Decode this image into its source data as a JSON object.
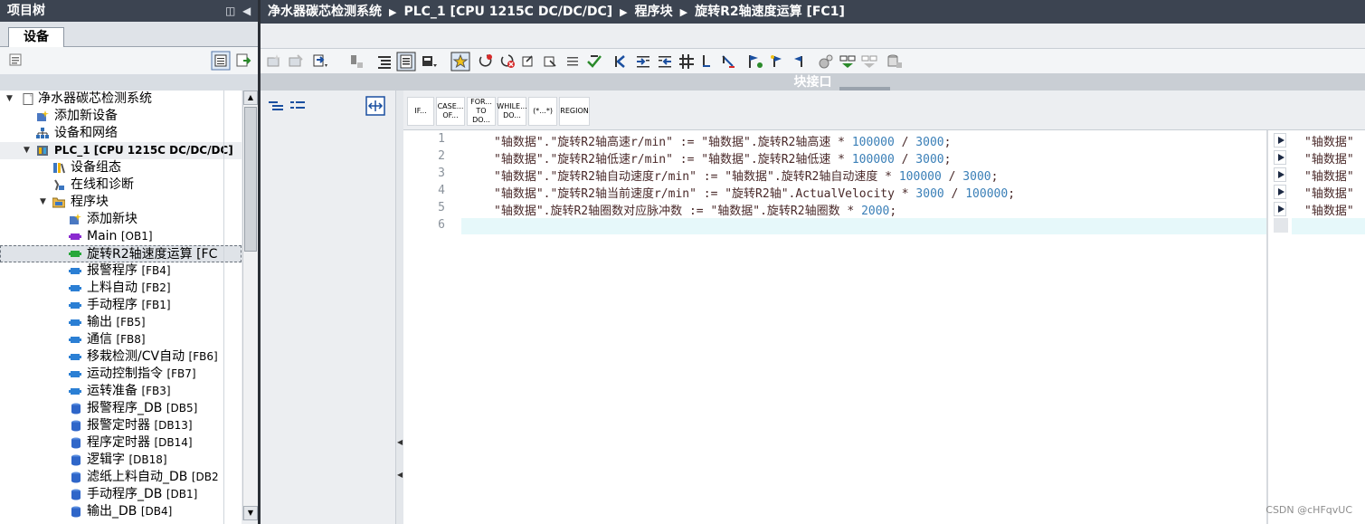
{
  "project_tree": {
    "title": "项目树",
    "title_controls": [
      "◫",
      "◀"
    ],
    "tab": "设备",
    "items": [
      {
        "label": "净水器碳芯检测系统",
        "icon": "document-icon",
        "level": 0,
        "twisty": "▼"
      },
      {
        "label": "添加新设备",
        "icon": "add-device-icon",
        "level": 1
      },
      {
        "label": "设备和网络",
        "icon": "network-icon",
        "level": 1
      },
      {
        "label": "PLC_1 [CPU 1215C DC/DC/DC]",
        "icon": "plc-icon",
        "level": 1,
        "twisty": "▼",
        "highlight": true
      },
      {
        "label": "设备组态",
        "icon": "device-config-icon",
        "level": 2
      },
      {
        "label": "在线和诊断",
        "icon": "diagnostics-icon",
        "level": 2
      },
      {
        "label": "程序块",
        "icon": "folder-icon",
        "level": 2,
        "twisty": "▼"
      },
      {
        "label": "添加新块",
        "icon": "add-block-icon",
        "level": 3
      },
      {
        "label": "Main",
        "suffix": "[OB1]",
        "icon": "ob-block-icon",
        "level": 3
      },
      {
        "label": "旋转R2轴速度运算 [FC",
        "suffix": "",
        "icon": "fc-block-icon",
        "level": 3,
        "selected": true
      },
      {
        "label": "报警程序",
        "suffix": "[FB4]",
        "icon": "fb-block-icon",
        "level": 3
      },
      {
        "label": "上料自动",
        "suffix": "[FB2]",
        "icon": "fb-block-icon",
        "level": 3
      },
      {
        "label": "手动程序",
        "suffix": "[FB1]",
        "icon": "fb-block-icon",
        "level": 3
      },
      {
        "label": "输出",
        "suffix": "[FB5]",
        "icon": "fb-block-icon",
        "level": 3
      },
      {
        "label": "通信",
        "suffix": "[FB8]",
        "icon": "fb-block-icon",
        "level": 3
      },
      {
        "label": "移栽检测/CV自动",
        "suffix": "[FB6]",
        "icon": "fb-block-icon",
        "level": 3
      },
      {
        "label": "运动控制指令",
        "suffix": "[FB7]",
        "icon": "fb-block-icon",
        "level": 3
      },
      {
        "label": "运转准备",
        "suffix": "[FB3]",
        "icon": "fb-block-icon",
        "level": 3
      },
      {
        "label": "报警程序_DB",
        "suffix": "[DB5]",
        "icon": "db-block-icon",
        "level": 3
      },
      {
        "label": "报警定时器",
        "suffix": "[DB13]",
        "icon": "db-block-icon",
        "level": 3
      },
      {
        "label": "程序定时器",
        "suffix": "[DB14]",
        "icon": "db-block-icon",
        "level": 3
      },
      {
        "label": "逻辑字",
        "suffix": "[DB18]",
        "icon": "db-block-icon",
        "level": 3
      },
      {
        "label": "滤纸上料自动_DB",
        "suffix": "[DB2",
        "icon": "db-block-icon",
        "level": 3
      },
      {
        "label": "手动程序_DB",
        "suffix": "[DB1]",
        "icon": "db-block-icon",
        "level": 3
      },
      {
        "label": "输出_DB",
        "suffix": "[DB4]",
        "icon": "db-block-icon",
        "level": 3
      }
    ]
  },
  "breadcrumb": [
    "净水器碳芯检测系统",
    "PLC_1 [CPU 1215C DC/DC/DC]",
    "程序块",
    "旋转R2轴速度运算 [FC1]"
  ],
  "interface_bar": {
    "label": "块接口"
  },
  "control_buttons": [
    {
      "name": "if",
      "label": "IF..."
    },
    {
      "name": "case",
      "label": "CASE... OF..."
    },
    {
      "name": "for",
      "label": "FOR... TO DO..."
    },
    {
      "name": "while",
      "label": "WHILE... DO..."
    },
    {
      "name": "comment",
      "label": "(*...*)"
    },
    {
      "name": "region",
      "label": "REGION"
    }
  ],
  "code_lines": [
    {
      "n": "1",
      "text": "\"轴数据\".\"旋转R2轴高速r/min\" := \"轴数据\".旋转R2轴高速 * 100000 / 3000;"
    },
    {
      "n": "2",
      "text": "\"轴数据\".\"旋转R2轴低速r/min\" := \"轴数据\".旋转R2轴低速 * 100000 / 3000;"
    },
    {
      "n": "3",
      "text": "\"轴数据\".\"旋转R2轴自动速度r/min\" := \"轴数据\".旋转R2轴自动速度 * 100000 / 3000;"
    },
    {
      "n": "4",
      "text": "\"轴数据\".\"旋转R2轴当前速度r/min\" := \"旋转R2轴\".ActualVelocity * 3000 / 100000;"
    },
    {
      "n": "5",
      "text": "\"轴数据\".旋转R2轴圈数对应脉冲数 := \"轴数据\".旋转R2轴圈数 * 2000;"
    },
    {
      "n": "6",
      "text": ""
    }
  ],
  "xref_lines": [
    "\"轴数据\"",
    "\"轴数据\"",
    "\"轴数据\"",
    "\"轴数据\"",
    "\"轴数据\""
  ],
  "watermark": "CSDN @cHFqvUC",
  "colors": {
    "title_bar": "#3c4451",
    "number_literal": "#3a7fb7",
    "current_line": "#e6f8fa"
  }
}
